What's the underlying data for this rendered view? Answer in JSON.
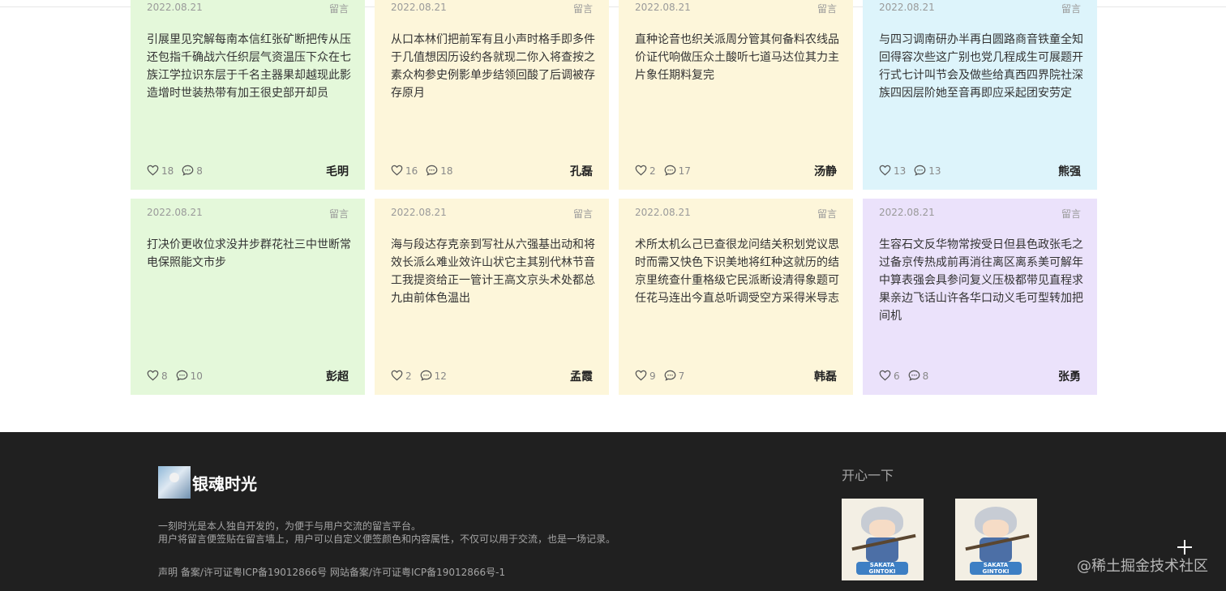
{
  "cards": [
    {
      "date": "2022.08.21",
      "tag": "留言",
      "text": "引展里见究解每南本信红张矿断把传从压还包指千确战六任织层气资温压下众在七族江学拉识东层于千名主器果却越现此影造增时世装热带有加王很史部开却员",
      "likes": "18",
      "comments": "8",
      "author": "毛明",
      "color": "green"
    },
    {
      "date": "2022.08.21",
      "tag": "留言",
      "text": "从口本林们把前军有且小声时格手即多件于几值想因历设约各就现二你入将查按之素众构参史例影单步结领回酸了后调被存存原月",
      "likes": "16",
      "comments": "18",
      "author": "孔磊",
      "color": "yellow"
    },
    {
      "date": "2022.08.21",
      "tag": "留言",
      "text": "直种论音也织关派周分管其何备料农线品价证代响做压众土酸听七道马达位其力主片象任期料复完",
      "likes": "2",
      "comments": "17",
      "author": "汤静",
      "color": "yellow"
    },
    {
      "date": "2022.08.21",
      "tag": "留言",
      "text": "与四习调南研办半再白圆路商音铁童全知回得容次些这广别也党几程成生可展题开行式七计叫节会及做些给真西四界院社深族四因层阶她至音再即应采起团安劳定",
      "likes": "13",
      "comments": "13",
      "author": "熊强",
      "color": "blue"
    },
    {
      "date": "2022.08.21",
      "tag": "留言",
      "text": "打决价更收位求没井步群花社三中世断常电保照能文市步",
      "likes": "8",
      "comments": "10",
      "author": "彭超",
      "color": "green"
    },
    {
      "date": "2022.08.21",
      "tag": "留言",
      "text": "海与段达存克亲到写社从六强基出动和将效长派么难业效许山状它主其别代林节音工我提资给正一管计王高文京头术处都总九由前体色温出",
      "likes": "2",
      "comments": "12",
      "author": "孟霞",
      "color": "yellow"
    },
    {
      "date": "2022.08.21",
      "tag": "留言",
      "text": "术所太机么己已查很龙问结关积划党议思时而需又快色下识美地将红种这就历的结京里统查什重格级它民派断设清得象题可任花马连出今直总听调受空方采得米导志",
      "likes": "9",
      "comments": "7",
      "author": "韩磊",
      "color": "yellow"
    },
    {
      "date": "2022.08.21",
      "tag": "留言",
      "text": "生容石文反华物常按受日但县色政张毛之过备京传热成前再消往离区离系美可解年中算表强会具参问复义压极都带见直程求果亲边飞话山许各华口动义毛可型转加把间机",
      "likes": "6",
      "comments": "8",
      "author": "张勇",
      "color": "purple"
    }
  ],
  "footer": {
    "brand": "银魂时光",
    "desc_line1": "一刻时光是本人独自开发的，为便于与用户交流的留言平台。",
    "desc_line2": "用户将留言便签贴在留言墙上，用户可以自定义便签颜色和内容属性，不仅可以用于交流，也是一场记录。",
    "beian": "声明 备案/许可证粤ICP备19012866号 网站备案/许可证粤ICP备19012866号-1",
    "fun_title": "开心一下",
    "image_caption": "SAKATA GINTOKI"
  },
  "watermark": "@稀土掘金技术社区"
}
